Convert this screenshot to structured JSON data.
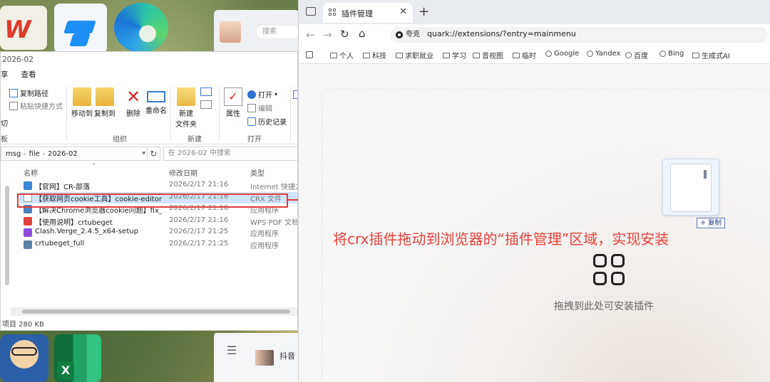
{
  "desktop": {
    "top_app_search": "搜索",
    "taskbar_label": "抖音"
  },
  "explorer": {
    "title": "2026-02",
    "menu_tabs": [
      "享",
      "查看"
    ],
    "ribbon": {
      "copy_path": "复制路径",
      "paste_shortcut": "粘贴快捷方式",
      "cut": "切",
      "clipboard_group": "板",
      "move_to": "移动到",
      "copy_to": "复制到",
      "delete": "删除",
      "rename": "重命名",
      "organize_group": "组织",
      "new_folder_line1": "新建",
      "new_folder_line2": "文件夹",
      "new_group": "新建",
      "properties": "属性",
      "open": "打开",
      "edit": "编辑",
      "history": "历史记录",
      "open_group": "打开"
    },
    "address": {
      "crumbs": [
        "msg",
        "file",
        "2026-02"
      ],
      "search_placeholder": "在 2026-02 中搜索"
    },
    "columns": {
      "name": "名称",
      "date": "修改日期",
      "type": "类型"
    },
    "files": [
      {
        "name": "【官网】CR-部落",
        "date": "2026/2/17 21:16",
        "type": "Internet 快捷方式",
        "icon_color": "#3a86d8"
      },
      {
        "name": "【获取网页cookie工具】cookie-editor...",
        "date": "2026/2/17 21:16",
        "type": "CRX 文件",
        "icon_color": "#ffffff"
      },
      {
        "name": "【解决Chrome浏览器cookie问题】fix_c...",
        "date": "2026/2/17 21:16",
        "type": "应用程序",
        "icon_color": "#4a7fc0"
      },
      {
        "name": "【使用说明】crtubeget",
        "date": "2026/2/17 21:16",
        "type": "WPS PDF 文档",
        "icon_color": "#e0443a"
      },
      {
        "name": "Clash.Verge_2.4.5_x64-setup",
        "date": "2026/2/17 21:25",
        "type": "应用程序",
        "icon_color": "#8c4bd6"
      },
      {
        "name": "crtubeget_full",
        "date": "2026/2/17 21:25",
        "type": "应用程序",
        "icon_color": "#5c7fa8"
      }
    ],
    "status": "项目  280 KB"
  },
  "browser": {
    "tab_title": "插件管理",
    "url_chip": "夸克",
    "url": "quark://extensions/?entry=mainmenu",
    "bookmarks": [
      {
        "label": "个人",
        "icon": "folder-icon"
      },
      {
        "label": "科技",
        "icon": "folder-icon"
      },
      {
        "label": "求职就业",
        "icon": "folder-icon"
      },
      {
        "label": "学习",
        "icon": "folder-icon"
      },
      {
        "label": "音视图",
        "icon": "folder-icon"
      },
      {
        "label": "临时",
        "icon": "folder-icon"
      },
      {
        "label": "Google",
        "icon": "globe-icon"
      },
      {
        "label": "Yandex",
        "icon": "globe-icon"
      },
      {
        "label": "百度",
        "icon": "globe-icon"
      },
      {
        "label": "Bing",
        "icon": "search-icon"
      },
      {
        "label": "生成式AI",
        "icon": "folder-icon"
      }
    ],
    "copy_badge": "+ 复制",
    "instruction": "将crx插件拖动到浏览器的“插件管理”区域，实现安装",
    "drop_hint": "拖拽到此处可安装插件",
    "accent_red": "#e8413a"
  }
}
